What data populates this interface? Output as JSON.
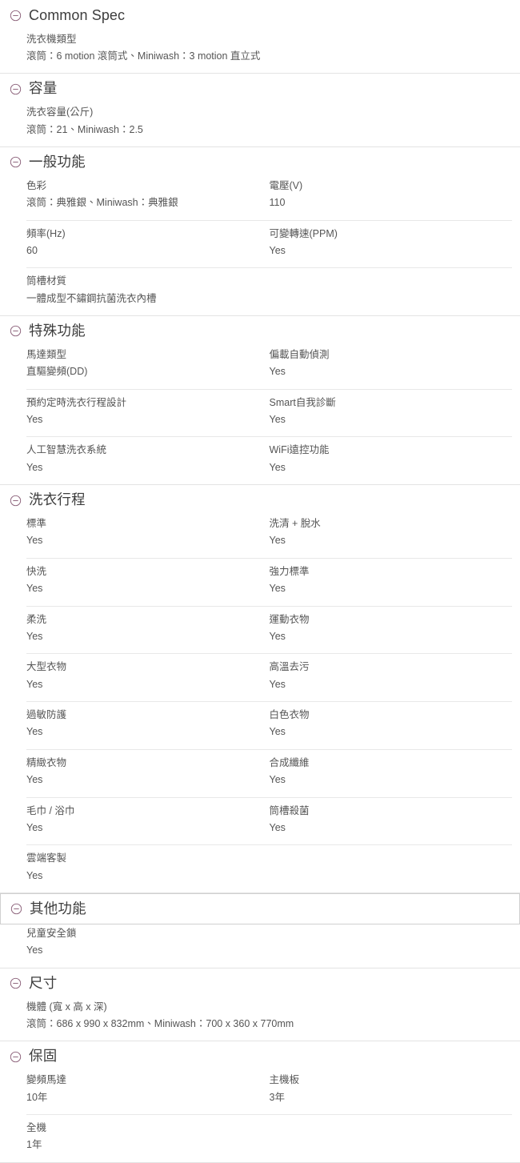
{
  "page": {
    "collapse_icon_name": "minus-circle-icon",
    "accent_color": "#8a5f78",
    "text_color": "#555555",
    "heading_color": "#3d3d3d",
    "divider_color": "#e3e3e3",
    "row_divider_color": "#e8e8e8"
  },
  "sections": [
    {
      "id": "common-spec",
      "title": "Common Spec",
      "latin": true,
      "focused": false,
      "rows": [
        [
          {
            "label": "洗衣機類型",
            "value": "滾筒：6 motion 滾筒式、Miniwash：3 motion 直立式",
            "full": true
          }
        ]
      ]
    },
    {
      "id": "capacity",
      "title": "容量",
      "latin": false,
      "focused": false,
      "rows": [
        [
          {
            "label": "洗衣容量(公斤)",
            "value": "滾筒：21、Miniwash：2.5",
            "full": true
          }
        ]
      ]
    },
    {
      "id": "general-function",
      "title": "一般功能",
      "latin": false,
      "focused": false,
      "rows": [
        [
          {
            "label": "色彩",
            "value": "滾筒：典雅銀、Miniwash：典雅銀"
          },
          {
            "label": "電壓(V)",
            "value": "110"
          }
        ],
        [
          {
            "label": "頻率(Hz)",
            "value": "60"
          },
          {
            "label": "可變轉速(PPM)",
            "value": "Yes"
          }
        ],
        [
          {
            "label": "筒槽材質",
            "value": "一體成型不鏽鋼抗菌洗衣內槽",
            "full": true
          }
        ]
      ]
    },
    {
      "id": "special-function",
      "title": "特殊功能",
      "latin": false,
      "focused": false,
      "rows": [
        [
          {
            "label": "馬達類型",
            "value": "直驅變頻(DD)"
          },
          {
            "label": "偏載自動偵測",
            "value": "Yes"
          }
        ],
        [
          {
            "label": "預約定時洗衣行程設計",
            "value": "Yes"
          },
          {
            "label": "Smart自我診斷",
            "value": "Yes"
          }
        ],
        [
          {
            "label": "人工智慧洗衣系統",
            "value": "Yes"
          },
          {
            "label": "WiFi遠控功能",
            "value": "Yes"
          }
        ]
      ]
    },
    {
      "id": "wash-programs",
      "title": "洗衣行程",
      "latin": false,
      "focused": false,
      "rows": [
        [
          {
            "label": "標準",
            "value": "Yes"
          },
          {
            "label": "洗清 + 脫水",
            "value": "Yes"
          }
        ],
        [
          {
            "label": "快洗",
            "value": "Yes"
          },
          {
            "label": "強力標準",
            "value": "Yes"
          }
        ],
        [
          {
            "label": "柔洗",
            "value": "Yes"
          },
          {
            "label": "運動衣物",
            "value": "Yes"
          }
        ],
        [
          {
            "label": "大型衣物",
            "value": "Yes"
          },
          {
            "label": "高溫去污",
            "value": "Yes"
          }
        ],
        [
          {
            "label": "過敏防護",
            "value": "Yes"
          },
          {
            "label": "白色衣物",
            "value": "Yes"
          }
        ],
        [
          {
            "label": "精緻衣物",
            "value": "Yes"
          },
          {
            "label": "合成纖維",
            "value": "Yes"
          }
        ],
        [
          {
            "label": "毛巾 / 浴巾",
            "value": "Yes"
          },
          {
            "label": "筒槽殺菌",
            "value": "Yes"
          }
        ],
        [
          {
            "label": "雲端客製",
            "value": "Yes",
            "full": true
          }
        ]
      ]
    },
    {
      "id": "other-function",
      "title": "其他功能",
      "latin": false,
      "focused": true,
      "rows": [
        [
          {
            "label": "兒童安全鎖",
            "value": "Yes",
            "full": true
          }
        ]
      ]
    },
    {
      "id": "dimensions",
      "title": "尺寸",
      "latin": false,
      "focused": false,
      "rows": [
        [
          {
            "label": "機體 (寬 x 高 x 深)",
            "value": "滾筒：686 x 990 x 832mm、Miniwash：700 x 360 x 770mm",
            "full": true
          }
        ]
      ]
    },
    {
      "id": "warranty",
      "title": "保固",
      "latin": false,
      "focused": false,
      "rows": [
        [
          {
            "label": "變頻馬達",
            "value": "10年"
          },
          {
            "label": "主機板",
            "value": "3年"
          }
        ],
        [
          {
            "label": "全機",
            "value": "1年",
            "full": true
          }
        ]
      ]
    }
  ]
}
